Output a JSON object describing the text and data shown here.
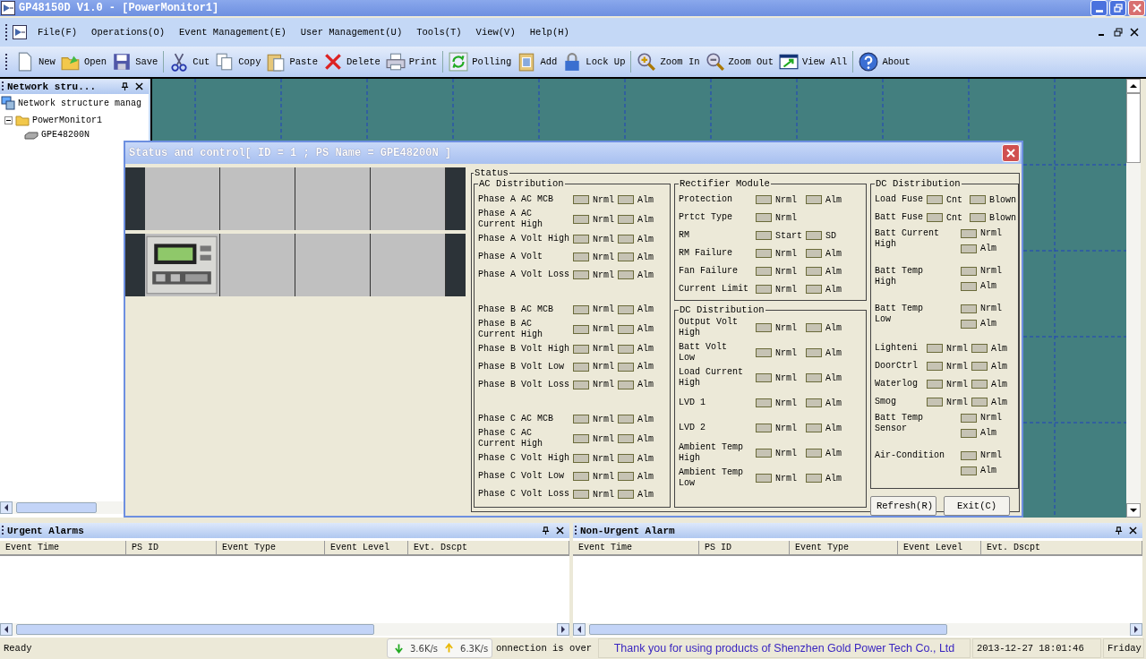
{
  "window": {
    "title": "GP48150D V1.0 - [PowerMonitor1]"
  },
  "menu": [
    "File(F)",
    "Operations(O)",
    "Event Management(E)",
    "User Management(U)",
    "Tools(T)",
    "View(V)",
    "Help(H)"
  ],
  "toolbar": [
    {
      "buttons": [
        "New",
        "Open",
        "Save"
      ]
    },
    {
      "buttons": [
        "Cut",
        "Copy",
        "Paste",
        "Delete",
        "Print"
      ]
    },
    {
      "buttons": [
        "Polling",
        "Add",
        "Lock Up"
      ]
    },
    {
      "buttons": [
        "Zoom In",
        "Zoom Out",
        "View All"
      ]
    },
    {
      "buttons": [
        "About"
      ]
    }
  ],
  "network_panel": {
    "title": "Network stru...",
    "tree": [
      {
        "label": "Network structure manag",
        "children": [
          {
            "label": "PowerMonitor1",
            "expanded": true,
            "children": [
              {
                "label": "GPE48200N"
              }
            ]
          }
        ]
      }
    ]
  },
  "dialog": {
    "title": "Status and control[ ID = 1 ; PS Name = GPE48200N ]",
    "status": {
      "title": "Status",
      "groups": [
        {
          "title": "AC Distribution",
          "sections": [
            {
              "rows": [
                {
                  "label": "Phase A AC MCB",
                  "kind": "inline",
                  "indicators": [
                    "Nrml",
                    "Alm"
                  ]
                },
                {
                  "label": "Phase A AC\nCurrent High",
                  "kind": "inline",
                  "indicators": [
                    "Nrml",
                    "Alm"
                  ]
                },
                {
                  "label": "Phase A Volt High",
                  "kind": "inline",
                  "indicators": [
                    "Nrml",
                    "Alm"
                  ]
                },
                {
                  "label": "Phase A Volt",
                  "kind": "inline",
                  "indicators": [
                    "Nrml",
                    "Alm"
                  ]
                },
                {
                  "label": "Phase A Volt Loss",
                  "kind": "inline",
                  "indicators": [
                    "Nrml",
                    "Alm"
                  ]
                }
              ]
            },
            {
              "rows": [
                {
                  "label": "Phase B AC MCB",
                  "kind": "inline",
                  "indicators": [
                    "Nrml",
                    "Alm"
                  ]
                },
                {
                  "label": "Phase B AC\nCurrent High",
                  "kind": "inline",
                  "indicators": [
                    "Nrml",
                    "Alm"
                  ]
                },
                {
                  "label": "Phase B Volt High",
                  "kind": "inline",
                  "indicators": [
                    "Nrml",
                    "Alm"
                  ]
                },
                {
                  "label": "Phase B Volt Low",
                  "kind": "inline",
                  "indicators": [
                    "Nrml",
                    "Alm"
                  ]
                },
                {
                  "label": "Phase B Volt Loss",
                  "kind": "inline",
                  "indicators": [
                    "Nrml",
                    "Alm"
                  ]
                }
              ]
            },
            {
              "rows": [
                {
                  "label": "Phase C AC MCB",
                  "kind": "inline",
                  "indicators": [
                    "Nrml",
                    "Alm"
                  ]
                },
                {
                  "label": "Phase C AC\nCurrent High",
                  "kind": "inline",
                  "indicators": [
                    "Nrml",
                    "Alm"
                  ]
                },
                {
                  "label": "Phase C Volt High",
                  "kind": "inline",
                  "indicators": [
                    "Nrml",
                    "Alm"
                  ]
                },
                {
                  "label": "Phase C Volt Low",
                  "kind": "inline",
                  "indicators": [
                    "Nrml",
                    "Alm"
                  ]
                },
                {
                  "label": "Phase C Volt Loss",
                  "kind": "inline",
                  "indicators": [
                    "Nrml",
                    "Alm"
                  ]
                }
              ]
            }
          ]
        },
        {
          "title": "Rectifier Module",
          "sections": [
            {
              "rows": [
                {
                  "label": "Protection",
                  "kind": "inline",
                  "indicators": [
                    "Nrml",
                    "Alm"
                  ]
                },
                {
                  "label": "Prtct Type",
                  "kind": "inline",
                  "indicators": [
                    "Nrml"
                  ]
                },
                {
                  "label": "RM",
                  "kind": "inline",
                  "indicators": [
                    "Start",
                    "SD"
                  ]
                },
                {
                  "label": "RM Failure",
                  "kind": "inline",
                  "indicators": [
                    "Nrml",
                    "Alm"
                  ]
                },
                {
                  "label": "Fan Failure",
                  "kind": "inline",
                  "indicators": [
                    "Nrml",
                    "Alm"
                  ]
                },
                {
                  "label": "Current Limit",
                  "kind": "inline",
                  "indicators": [
                    "Nrml",
                    "Alm"
                  ]
                }
              ]
            }
          ]
        },
        {
          "title": "DC Distribution",
          "sections": [
            {
              "rows": [
                {
                  "label": "Output Volt\nHigh",
                  "kind": "inline",
                  "indicators": [
                    "Nrml",
                    "Alm"
                  ]
                },
                {
                  "label": "Batt Volt\nLow",
                  "kind": "inline",
                  "indicators": [
                    "Nrml",
                    "Alm"
                  ]
                },
                {
                  "label": "Load Current\nHigh",
                  "kind": "inline",
                  "indicators": [
                    "Nrml",
                    "Alm"
                  ]
                },
                {
                  "label": "LVD 1",
                  "kind": "inline",
                  "indicators": [
                    "Nrml",
                    "Alm"
                  ]
                },
                {
                  "label": "LVD 2",
                  "kind": "inline",
                  "indicators": [
                    "Nrml",
                    "Alm"
                  ]
                },
                {
                  "label": "Ambient Temp\nHigh",
                  "kind": "inline",
                  "indicators": [
                    "Nrml",
                    "Alm"
                  ]
                },
                {
                  "label": "Ambient Temp\nLow",
                  "kind": "inline",
                  "indicators": [
                    "Nrml",
                    "Alm"
                  ]
                }
              ]
            }
          ]
        },
        {
          "title": "DC Distribution",
          "sections": [
            {
              "rows": [
                {
                  "label": "Load Fuse",
                  "kind": "inline",
                  "indicators": [
                    "Cnt",
                    "Blown"
                  ]
                },
                {
                  "label": "Batt Fuse",
                  "kind": "inline",
                  "indicators": [
                    "Cnt",
                    "Blown"
                  ]
                },
                {
                  "label": "Batt Current\nHigh",
                  "kind": "stacked",
                  "indicators": [
                    "Nrml",
                    "Alm"
                  ]
                },
                {
                  "label": "Batt Temp\nHigh",
                  "kind": "stacked",
                  "indicators": [
                    "Nrml",
                    "Alm"
                  ]
                },
                {
                  "label": "Batt Temp\nLow",
                  "kind": "stacked",
                  "indicators": [
                    "Nrml",
                    "Alm"
                  ]
                },
                {
                  "label": "Lighteni",
                  "kind": "inline",
                  "indicators": [
                    "Nrml",
                    "Alm"
                  ]
                },
                {
                  "label": "DoorCtrl",
                  "kind": "inline",
                  "indicators": [
                    "Nrml",
                    "Alm"
                  ]
                },
                {
                  "label": "Waterlog",
                  "kind": "inline",
                  "indicators": [
                    "Nrml",
                    "Alm"
                  ]
                },
                {
                  "label": "Smog",
                  "kind": "inline",
                  "indicators": [
                    "Nrml",
                    "Alm"
                  ]
                },
                {
                  "label": "Batt Temp\nSensor",
                  "kind": "stacked",
                  "indicators": [
                    "Nrml",
                    "Alm"
                  ]
                },
                {
                  "label": "Air-Condition",
                  "kind": "stacked",
                  "indicators": [
                    "Nrml",
                    "Alm"
                  ]
                }
              ]
            }
          ]
        }
      ]
    },
    "buttons": [
      "Refresh(R)",
      "Exit(C)"
    ]
  },
  "urgent_alarms": {
    "title": "Urgent Alarms",
    "columns": [
      "Event Time",
      "PS ID",
      "Event Type",
      "Event Level",
      "Evt. Dscpt"
    ]
  },
  "non_urgent_alarms": {
    "title": "Non-Urgent Alarm",
    "columns": [
      "Event Time",
      "PS ID",
      "Event Type",
      "Event Level",
      "Evt. Dscpt"
    ]
  },
  "speed_meter": {
    "download": "3.6K/s",
    "upload": "6.3K/s"
  },
  "status_bar": {
    "state": "Ready",
    "connection": "onnection is over",
    "message": "Thank you for using products of Shenzhen Gold Power Tech Co., Ltd",
    "datetime": "2013-12-27 18:01:46",
    "weekday": "Friday"
  }
}
